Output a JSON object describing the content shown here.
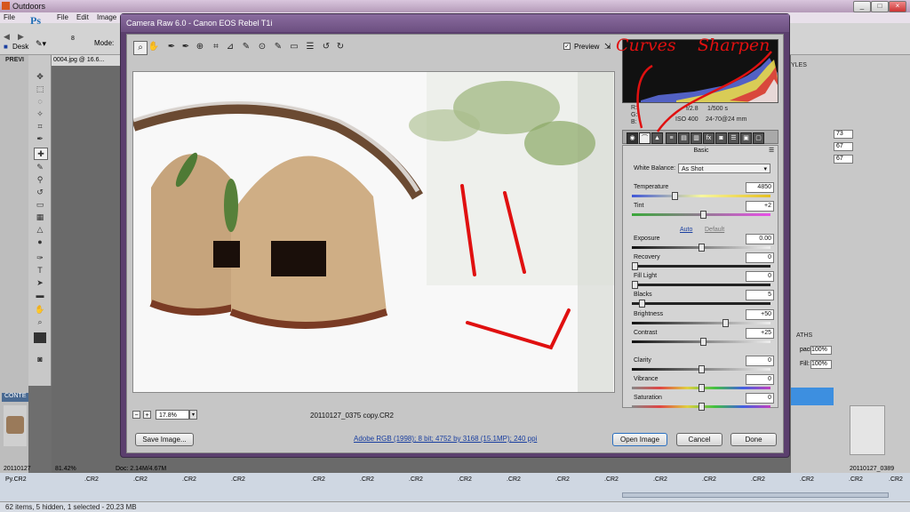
{
  "window": {
    "title": "Outdoors"
  },
  "menu": {
    "items": [
      "File",
      "Edit",
      "Image"
    ]
  },
  "options_bar": {
    "mode_label": "Mode:",
    "brush_size": "8",
    "app_logo": "Ps"
  },
  "doc": {
    "left_tab": "PREVI",
    "doc_name": "0004.jpg @ 16.6...",
    "desk_label": "Desk"
  },
  "camera_raw": {
    "title": "Camera Raw 6.0  -  Canon EOS Rebel T1i",
    "preview_label": "Preview",
    "preview_checked": true,
    "zoom": "17.8%",
    "filename": "20110127_0375 copy.CR2",
    "workflow": "Adobe RGB (1998); 8 bit; 4752 by 3168 (15.1MP); 240 ppi",
    "buttons": {
      "save": "Save Image...",
      "open": "Open Image",
      "cancel": "Cancel",
      "done": "Done"
    },
    "camera_info": {
      "r": "R:",
      "g": "G:",
      "b": "B:",
      "aperture": "f/2.8",
      "shutter": "1/500 s",
      "iso": "ISO 400",
      "lens": "24-70@24 mm"
    },
    "panel": {
      "title": "Basic",
      "white_balance_label": "White Balance:",
      "white_balance_value": "As Shot",
      "auto": "Auto",
      "default": "Default",
      "sliders": [
        {
          "label": "Temperature",
          "value": "4850",
          "pos": 0.3
        },
        {
          "label": "Tint",
          "value": "+2",
          "pos": 0.51
        },
        {
          "label": "Exposure",
          "value": "0.00",
          "pos": 0.5
        },
        {
          "label": "Recovery",
          "value": "0",
          "pos": 0.0
        },
        {
          "label": "Fill Light",
          "value": "0",
          "pos": 0.0
        },
        {
          "label": "Blacks",
          "value": "5",
          "pos": 0.05
        },
        {
          "label": "Brightness",
          "value": "+50",
          "pos": 0.68
        },
        {
          "label": "Contrast",
          "value": "+25",
          "pos": 0.51
        },
        {
          "label": "Clarity",
          "value": "0",
          "pos": 0.5
        },
        {
          "label": "Vibrance",
          "value": "0",
          "pos": 0.5
        },
        {
          "label": "Saturation",
          "value": "0",
          "pos": 0.5
        }
      ]
    },
    "annotations": {
      "curves": "Curves",
      "sharpen": "Sharpen"
    }
  },
  "right_panel": {
    "values": [
      "73",
      "67",
      "67"
    ],
    "opacity_label": "pacity:",
    "opacity": "100%",
    "fill_label": "Fill:",
    "fill": "100%",
    "tab_styles": "YLES",
    "tab_paths": "ATHS"
  },
  "bottom": {
    "doc_zoom": "81.42%",
    "doc_size": "Doc: 2.14M/4.67M",
    "left_thumb_label": "20110127",
    "right_thumb_label": "20110127_0389",
    "status": "62 items, 5 hidden, 1 selected - 20.23 MB",
    "cr2_labels": [
      ".CR2",
      ".CR2",
      ".CR2",
      ".CR2",
      ".CR2",
      ".CR2",
      ".CR2",
      ".CR2",
      ".CR2",
      ".CR2",
      ".CR2",
      ".CR2",
      ".CR2",
      ".CR2",
      ".CR2",
      ".CR2",
      ".CR2"
    ],
    "contents_tab": "CONTE",
    "py_label": "Py.CR2"
  }
}
